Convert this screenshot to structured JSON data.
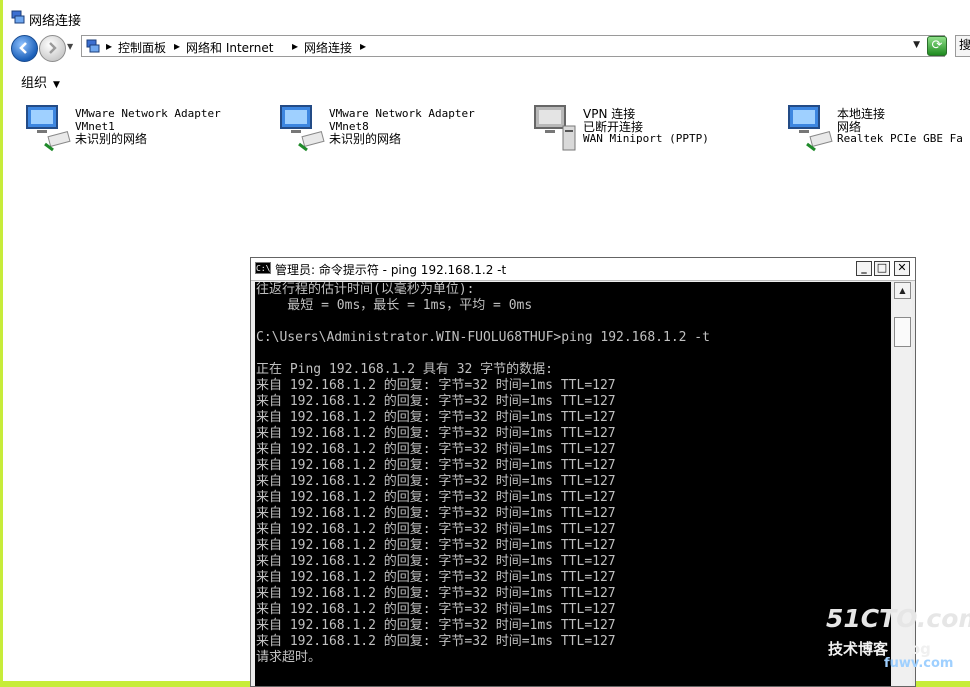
{
  "window": {
    "title": "网络连接"
  },
  "address": {
    "crumbs": [
      "控制面板",
      "网络和 Internet",
      "网络连接"
    ],
    "separator": "▸",
    "search_partial": "搜"
  },
  "commandbar": {
    "organize": "组织"
  },
  "adapters": [
    {
      "name": "VMware Network Adapter",
      "device": "VMnet1",
      "status": "未识别的网络"
    },
    {
      "name": "VMware Network Adapter",
      "device": "VMnet8",
      "status": "未识别的网络"
    },
    {
      "name": "VPN 连接",
      "device": "已断开连接",
      "status": "WAN Miniport (PPTP)"
    },
    {
      "name": "本地连接",
      "device": "网络",
      "status": "Realtek PCIe GBE Fa"
    }
  ],
  "cmd": {
    "icon_text": "C:\\",
    "title": "管理员: 命令提示符 - ping  192.168.1.2 -t",
    "lines": [
      "往返行程的估计时间(以毫秒为单位):",
      "    最短 = 0ms，最长 = 1ms，平均 = 0ms",
      "",
      "C:\\Users\\Administrator.WIN-FUOLU68THUF>ping 192.168.1.2 -t",
      "",
      "正在 Ping 192.168.1.2 具有 32 字节的数据:",
      "来自 192.168.1.2 的回复: 字节=32 时间=1ms TTL=127",
      "来自 192.168.1.2 的回复: 字节=32 时间=1ms TTL=127",
      "来自 192.168.1.2 的回复: 字节=32 时间=1ms TTL=127",
      "来自 192.168.1.2 的回复: 字节=32 时间=1ms TTL=127",
      "来自 192.168.1.2 的回复: 字节=32 时间=1ms TTL=127",
      "来自 192.168.1.2 的回复: 字节=32 时间=1ms TTL=127",
      "来自 192.168.1.2 的回复: 字节=32 时间=1ms TTL=127",
      "来自 192.168.1.2 的回复: 字节=32 时间=1ms TTL=127",
      "来自 192.168.1.2 的回复: 字节=32 时间=1ms TTL=127",
      "来自 192.168.1.2 的回复: 字节=32 时间=1ms TTL=127",
      "来自 192.168.1.2 的回复: 字节=32 时间=1ms TTL=127",
      "来自 192.168.1.2 的回复: 字节=32 时间=1ms TTL=127",
      "来自 192.168.1.2 的回复: 字节=32 时间=1ms TTL=127",
      "来自 192.168.1.2 的回复: 字节=32 时间=1ms TTL=127",
      "来自 192.168.1.2 的回复: 字节=32 时间=1ms TTL=127",
      "来自 192.168.1.2 的回复: 字节=32 时间=1ms TTL=127",
      "来自 192.168.1.2 的回复: 字节=32 时间=1ms TTL=127",
      "请求超时。"
    ]
  },
  "watermark": {
    "logo": "51CTO.com",
    "sub": "技术博客",
    "site": "Blog",
    "url": "fuwv.com"
  },
  "colors": {
    "desktop": "#c7ec3a",
    "console_bg": "#000000",
    "console_fg": "#c0c0c0"
  }
}
